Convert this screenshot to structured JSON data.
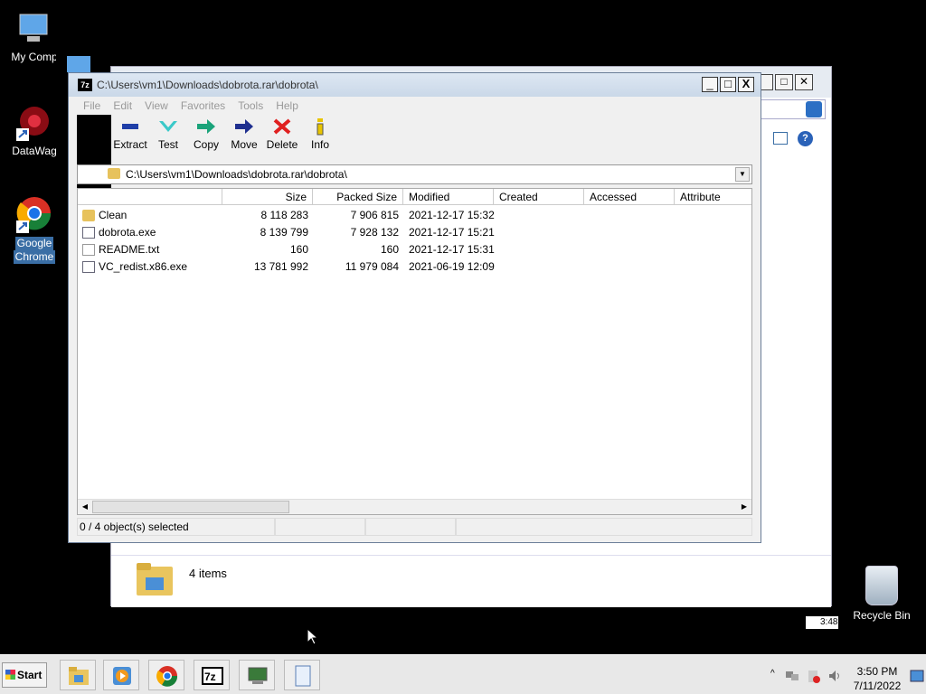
{
  "desktop": {
    "icons": [
      {
        "label": "My Comp"
      },
      {
        "label": "DataWag"
      },
      {
        "label": "Google Chrome",
        "line1": "Google",
        "line2": "Chrome"
      },
      {
        "label": "Recycle Bin"
      }
    ]
  },
  "bg_window": {
    "items_text": "4 items"
  },
  "window": {
    "title": "C:\\Users\\vm1\\Downloads\\dobrota.rar\\dobrota\\",
    "controls": {
      "minimize": "_",
      "maximize": "□",
      "close": "X"
    },
    "menu": [
      "File",
      "Edit",
      "View",
      "Favorites",
      "Tools",
      "Help"
    ],
    "toolbar": [
      {
        "label": "Extract",
        "icon": "extract-icon"
      },
      {
        "label": "Test",
        "icon": "test-icon"
      },
      {
        "label": "Copy",
        "icon": "copy-icon"
      },
      {
        "label": "Move",
        "icon": "move-icon"
      },
      {
        "label": "Delete",
        "icon": "delete-icon"
      },
      {
        "label": "Info",
        "icon": "info-icon"
      }
    ],
    "address": "C:\\Users\\vm1\\Downloads\\dobrota.rar\\dobrota\\",
    "columns": [
      "Size",
      "Packed Size",
      "Modified",
      "Created",
      "Accessed",
      "Attribute"
    ],
    "files": [
      {
        "name": "Clean",
        "type": "folder",
        "size": "8 118 283",
        "packed": "7 906 815",
        "modified": "2021-12-17 15:32"
      },
      {
        "name": "dobrota.exe",
        "type": "exe",
        "size": "8 139 799",
        "packed": "7 928 132",
        "modified": "2021-12-17 15:21"
      },
      {
        "name": "README.txt",
        "type": "txt",
        "size": "160",
        "packed": "160",
        "modified": "2021-12-17 15:31"
      },
      {
        "name": "VC_redist.x86.exe",
        "type": "exe",
        "size": "13 781 992",
        "packed": "11 979 084",
        "modified": "2021-06-19 12:09"
      }
    ],
    "status": "0 / 4 object(s) selected"
  },
  "taskbar": {
    "start_label": "Start",
    "time": "3:50 PM",
    "date": "7/11/2022",
    "mini_time": "3:48"
  }
}
